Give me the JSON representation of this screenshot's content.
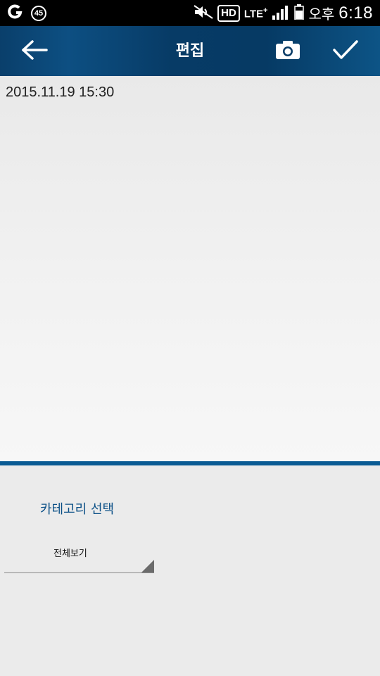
{
  "status_bar": {
    "notification_badge": "45",
    "hd": "HD",
    "network": "LTE",
    "network_plus": "+",
    "ampm": "오후",
    "time": "6:18"
  },
  "app_bar": {
    "title": "편집",
    "back_icon": "back-arrow-icon",
    "camera_icon": "camera-icon",
    "confirm_icon": "checkmark-icon",
    "color": "#063a64"
  },
  "editor": {
    "date": "2015.11.19 15:30",
    "content": ""
  },
  "category": {
    "label": "카테고리 선택",
    "selected": "전체보기"
  },
  "colors": {
    "accent": "#0a5b94",
    "category_label": "#0a4f86"
  }
}
